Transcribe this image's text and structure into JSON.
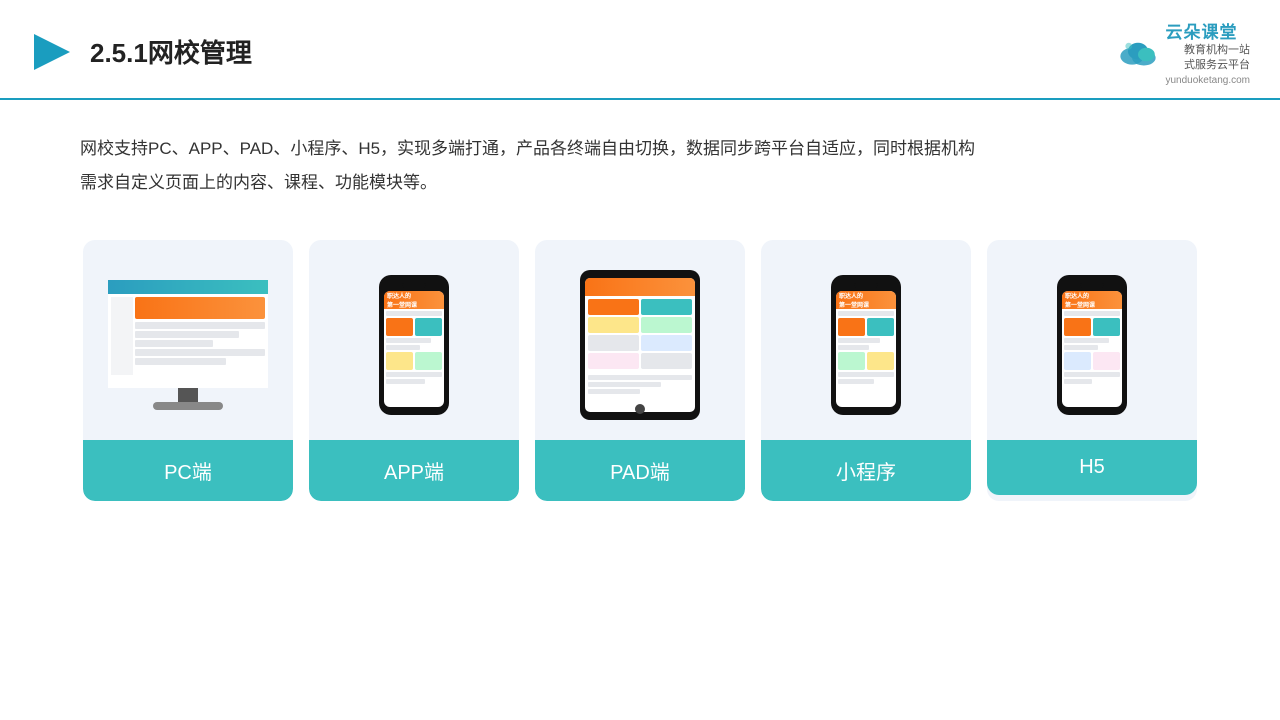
{
  "header": {
    "title": "2.5.1网校管理",
    "logo_main": "云朵课堂",
    "logo_sub1": "教育机构一站",
    "logo_sub2": "式服务云平台",
    "logo_url": "yunduoketang.com"
  },
  "description": {
    "line1": "网校支持PC、APP、PAD、小程序、H5，实现多端打通，产品各终端自由切换，数据同步跨平台自适应，同时根据机构",
    "line2": "需求自定义页面上的内容、课程、功能模块等。"
  },
  "cards": [
    {
      "id": "pc",
      "label": "PC端"
    },
    {
      "id": "app",
      "label": "APP端"
    },
    {
      "id": "pad",
      "label": "PAD端"
    },
    {
      "id": "miniprogram",
      "label": "小程序"
    },
    {
      "id": "h5",
      "label": "H5"
    }
  ],
  "colors": {
    "accent": "#3bbfbf",
    "header_line": "#1a9dbf",
    "play_color": "#1a9dbf",
    "card_bg": "#f0f4fa",
    "card_label_bg": "#3bbfbf"
  }
}
